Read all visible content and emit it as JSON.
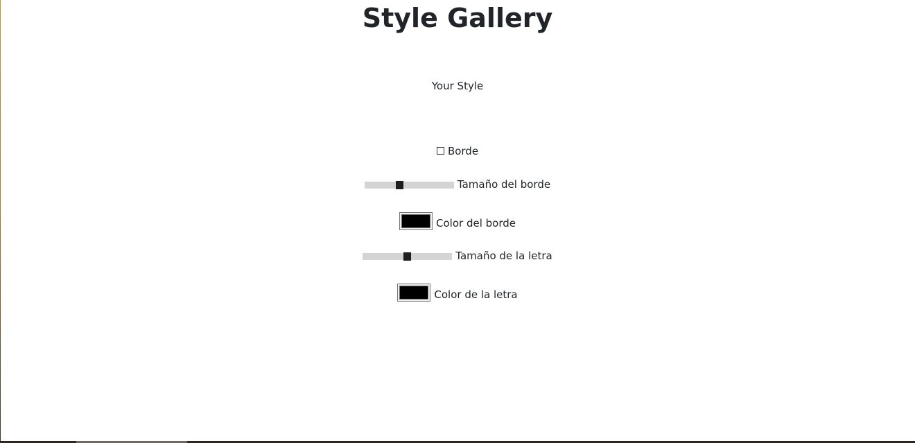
{
  "page": {
    "title": "Style Gallery",
    "preview_text": "Your Style"
  },
  "controls": {
    "border_checkbox": {
      "label": "Borde",
      "checked": false
    },
    "border_size": {
      "label": "Tamaño del borde",
      "value_fraction": 0.38
    },
    "border_color": {
      "label": "Color del borde",
      "color": "#000000"
    },
    "font_size": {
      "label": "Tamaño de la letra",
      "value_fraction": 0.5
    },
    "font_color": {
      "label": "Color de la letra",
      "color": "#000000"
    }
  }
}
